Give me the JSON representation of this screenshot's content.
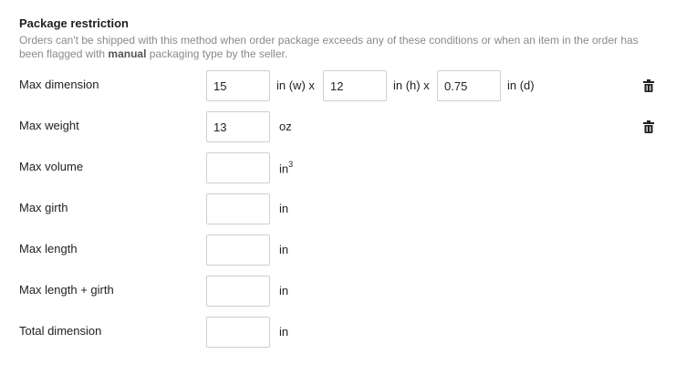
{
  "section": {
    "title": "Package restriction",
    "description_before": "Orders can't be shipped with this method when order package exceeds any of these conditions or when an item in the order has been flagged with ",
    "description_bold": "manual",
    "description_after": " packaging type by the seller."
  },
  "rows": {
    "max_dimension": {
      "label": "Max dimension",
      "width_value": "15",
      "width_unit": "in (w) x",
      "height_value": "12",
      "height_unit": "in (h) x",
      "depth_value": "0.75",
      "depth_unit": "in (d)"
    },
    "max_weight": {
      "label": "Max weight",
      "value": "13",
      "unit": "oz"
    },
    "max_volume": {
      "label": "Max volume",
      "value": "",
      "unit": "in",
      "unit_sup": "3"
    },
    "max_girth": {
      "label": "Max girth",
      "value": "",
      "unit": "in"
    },
    "max_length": {
      "label": "Max length",
      "value": "",
      "unit": "in"
    },
    "max_length_girth": {
      "label": "Max length + girth",
      "value": "",
      "unit": "in"
    },
    "total_dimension": {
      "label": "Total dimension",
      "value": "",
      "unit": "in"
    }
  },
  "icons": {
    "delete": "trash-icon"
  }
}
